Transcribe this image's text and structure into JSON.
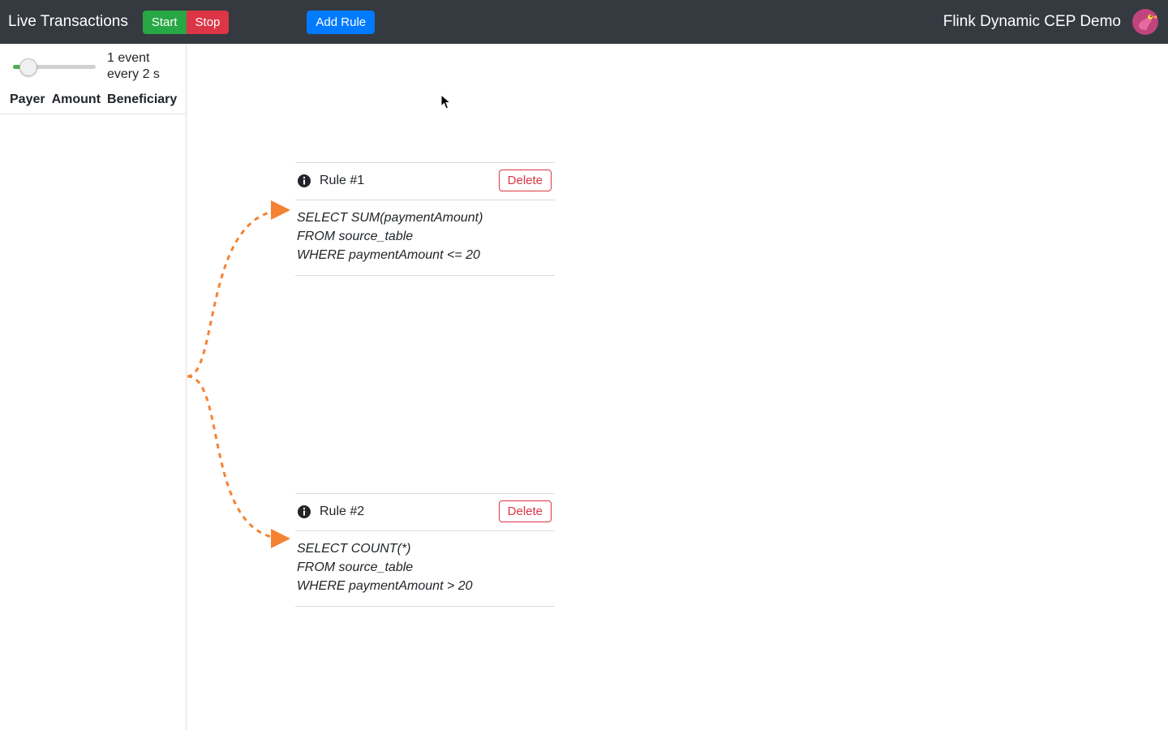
{
  "navbar": {
    "left_title": "Live Transactions",
    "start_label": "Start",
    "stop_label": "Stop",
    "add_rule_label": "Add Rule",
    "right_title": "Flink Dynamic CEP Demo"
  },
  "sidebar": {
    "rate_line1": "1 event",
    "rate_line2": "every 2 s",
    "columns": {
      "payer": "Payer",
      "amount": "Amount",
      "beneficiary": "Beneficiary"
    }
  },
  "rules": [
    {
      "title": "Rule #1",
      "delete_label": "Delete",
      "query_line1": "SELECT SUM(paymentAmount)",
      "query_line2": "FROM source_table",
      "query_line3": "WHERE paymentAmount <= 20"
    },
    {
      "title": "Rule #2",
      "delete_label": "Delete",
      "query_line1": "SELECT COUNT(*)",
      "query_line2": "FROM source_table",
      "query_line3": "WHERE paymentAmount > 20"
    }
  ],
  "colors": {
    "connector": "#f58233"
  }
}
